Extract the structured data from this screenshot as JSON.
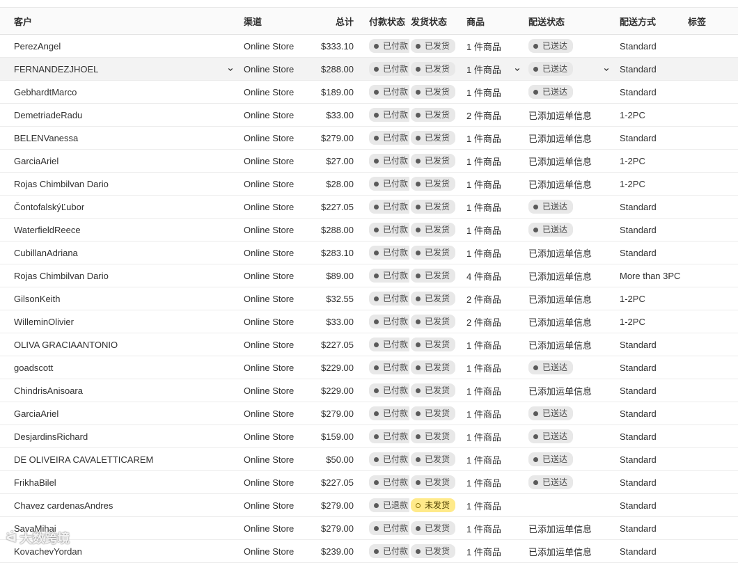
{
  "headers": {
    "customer": "客户",
    "channel": "渠道",
    "total": "总计",
    "payment": "付款状态",
    "fulfillment": "发货状态",
    "items": "商品",
    "delivery_status": "配送状态",
    "delivery_method": "配送方式",
    "tags": "标签"
  },
  "orders": [
    {
      "customer": "PerezAngel",
      "channel": "Online Store",
      "total": "$333.10",
      "payment": "已付款",
      "fulfillment": "已发货",
      "items": "1 件商品",
      "delivery": "已送达",
      "delivery_badge": true,
      "method": "Standard"
    },
    {
      "customer": "FERNANDEZJHOEL",
      "channel": "Online Store",
      "total": "$288.00",
      "payment": "已付款",
      "fulfillment": "已发货",
      "items": "1 件商品",
      "delivery": "已送达",
      "delivery_badge": true,
      "method": "Standard"
    },
    {
      "customer": "GebhardtMarco",
      "channel": "Online Store",
      "total": "$189.00",
      "payment": "已付款",
      "fulfillment": "已发货",
      "items": "1 件商品",
      "delivery": "已送达",
      "delivery_badge": true,
      "method": "Standard"
    },
    {
      "customer": "DemetriadeRadu",
      "channel": "Online Store",
      "total": "$33.00",
      "payment": "已付款",
      "fulfillment": "已发货",
      "items": "2 件商品",
      "delivery": "已添加运单信息",
      "delivery_badge": false,
      "method": "1-2PC"
    },
    {
      "customer": "BELENVanessa",
      "channel": "Online Store",
      "total": "$279.00",
      "payment": "已付款",
      "fulfillment": "已发货",
      "items": "1 件商品",
      "delivery": "已添加运单信息",
      "delivery_badge": false,
      "method": "Standard"
    },
    {
      "customer": "GarciaAriel",
      "channel": "Online Store",
      "total": "$27.00",
      "payment": "已付款",
      "fulfillment": "已发货",
      "items": "1 件商品",
      "delivery": "已添加运单信息",
      "delivery_badge": false,
      "method": "1-2PC"
    },
    {
      "customer": "Rojas Chimbilvan Dario",
      "channel": "Online Store",
      "total": "$28.00",
      "payment": "已付款",
      "fulfillment": "已发货",
      "items": "1 件商品",
      "delivery": "已添加运单信息",
      "delivery_badge": false,
      "method": "1-2PC"
    },
    {
      "customer": "ČontofalskýĽubor",
      "channel": "Online Store",
      "total": "$227.05",
      "payment": "已付款",
      "fulfillment": "已发货",
      "items": "1 件商品",
      "delivery": "已送达",
      "delivery_badge": true,
      "method": "Standard"
    },
    {
      "customer": "WaterfieldReece",
      "channel": "Online Store",
      "total": "$288.00",
      "payment": "已付款",
      "fulfillment": "已发货",
      "items": "1 件商品",
      "delivery": "已送达",
      "delivery_badge": true,
      "method": "Standard"
    },
    {
      "customer": "CubillanAdriana",
      "channel": "Online Store",
      "total": "$283.10",
      "payment": "已付款",
      "fulfillment": "已发货",
      "items": "1 件商品",
      "delivery": "已添加运单信息",
      "delivery_badge": false,
      "method": "Standard"
    },
    {
      "customer": "Rojas Chimbilvan Dario",
      "channel": "Online Store",
      "total": "$89.00",
      "payment": "已付款",
      "fulfillment": "已发货",
      "items": "4 件商品",
      "delivery": "已添加运单信息",
      "delivery_badge": false,
      "method": "More than 3PC"
    },
    {
      "customer": "GilsonKeith",
      "channel": "Online Store",
      "total": "$32.55",
      "payment": "已付款",
      "fulfillment": "已发货",
      "items": "2 件商品",
      "delivery": "已添加运单信息",
      "delivery_badge": false,
      "method": "1-2PC"
    },
    {
      "customer": "WilleminOlivier",
      "channel": "Online Store",
      "total": "$33.00",
      "payment": "已付款",
      "fulfillment": "已发货",
      "items": "2 件商品",
      "delivery": "已添加运单信息",
      "delivery_badge": false,
      "method": "1-2PC"
    },
    {
      "customer": "OLIVA GRACIAANTONIO",
      "channel": "Online Store",
      "total": "$227.05",
      "payment": "已付款",
      "fulfillment": "已发货",
      "items": "1 件商品",
      "delivery": "已添加运单信息",
      "delivery_badge": false,
      "method": "Standard"
    },
    {
      "customer": "goadscott",
      "channel": "Online Store",
      "total": "$229.00",
      "payment": "已付款",
      "fulfillment": "已发货",
      "items": "1 件商品",
      "delivery": "已送达",
      "delivery_badge": true,
      "method": "Standard"
    },
    {
      "customer": "ChindrisAnisoara",
      "channel": "Online Store",
      "total": "$229.00",
      "payment": "已付款",
      "fulfillment": "已发货",
      "items": "1 件商品",
      "delivery": "已添加运单信息",
      "delivery_badge": false,
      "method": "Standard"
    },
    {
      "customer": "GarciaAriel",
      "channel": "Online Store",
      "total": "$279.00",
      "payment": "已付款",
      "fulfillment": "已发货",
      "items": "1 件商品",
      "delivery": "已送达",
      "delivery_badge": true,
      "method": "Standard"
    },
    {
      "customer": "DesjardinsRichard",
      "channel": "Online Store",
      "total": "$159.00",
      "payment": "已付款",
      "fulfillment": "已发货",
      "items": "1 件商品",
      "delivery": "已送达",
      "delivery_badge": true,
      "method": "Standard"
    },
    {
      "customer": "DE OLIVEIRA CAVALETTICAREM",
      "channel": "Online Store",
      "total": "$50.00",
      "payment": "已付款",
      "fulfillment": "已发货",
      "items": "1 件商品",
      "delivery": "已送达",
      "delivery_badge": true,
      "method": "Standard"
    },
    {
      "customer": "FrikhaBilel",
      "channel": "Online Store",
      "total": "$227.05",
      "payment": "已付款",
      "fulfillment": "已发货",
      "items": "1 件商品",
      "delivery": "已送达",
      "delivery_badge": true,
      "method": "Standard"
    },
    {
      "customer": "Chavez cardenasAndres",
      "channel": "Online Store",
      "total": "$279.00",
      "payment": "已退款",
      "fulfillment": "未发货",
      "fulfillment_warn": true,
      "items": "1 件商品",
      "delivery": "",
      "delivery_badge": false,
      "method": "Standard"
    },
    {
      "customer": "SavaMihai",
      "channel": "Online Store",
      "total": "$279.00",
      "payment": "已付款",
      "fulfillment": "已发货",
      "items": "1 件商品",
      "delivery": "已添加运单信息",
      "delivery_badge": false,
      "method": "Standard"
    },
    {
      "customer": "KovachevYordan",
      "channel": "Online Store",
      "total": "$239.00",
      "payment": "已付款",
      "fulfillment": "已发货",
      "items": "1 件商品",
      "delivery": "已添加运单信息",
      "delivery_badge": false,
      "method": "Standard"
    }
  ],
  "hovered_row": 1,
  "watermark": "大数跨境",
  "colors": {
    "badge_bg": "#e8e8e8",
    "warn_bg": "#ffea8a",
    "header_bg": "#fafafa",
    "hover_bg": "#f3f3f3"
  }
}
